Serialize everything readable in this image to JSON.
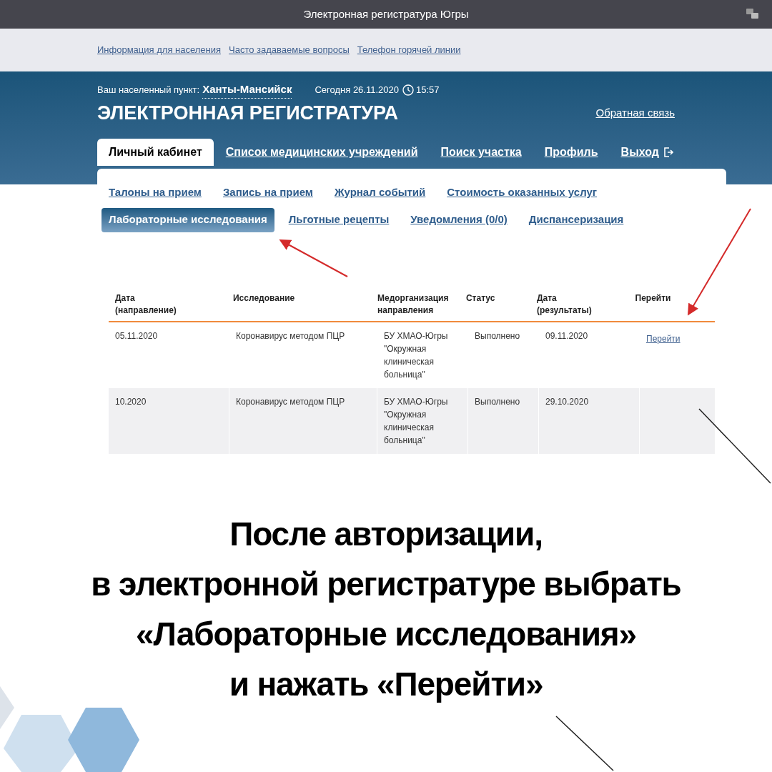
{
  "window": {
    "title": "Электронная регистратура Югры"
  },
  "top_links": [
    "Информация для населения",
    "Часто задаваемые вопросы",
    "Телефон горячей линии"
  ],
  "header": {
    "location_label": "Ваш населенный пункт:",
    "location": "Ханты-Мансийск",
    "today": "Сегодня 26.11.2020",
    "time": "15:57",
    "title": "ЭЛЕКТРОННАЯ РЕГИСТРАТУРА",
    "feedback": "Обратная связь"
  },
  "main_tabs": [
    {
      "label": "Личный кабинет",
      "selected": true,
      "kind": "tab"
    },
    {
      "label": "Список медицинских учреждений",
      "selected": false,
      "kind": "tab"
    },
    {
      "label": "Поиск участка",
      "selected": false,
      "kind": "tab"
    },
    {
      "label": "Профиль",
      "selected": false,
      "kind": "tab"
    },
    {
      "label": "Выход",
      "selected": false,
      "kind": "logout"
    }
  ],
  "sub_tabs": [
    [
      {
        "label": "Талоны на прием",
        "selected": false
      },
      {
        "label": "Запись на прием",
        "selected": false
      },
      {
        "label": "Журнал событий",
        "selected": false
      },
      {
        "label": "Стоимость оказанных услуг",
        "selected": false
      }
    ],
    [
      {
        "label": "Лабораторные исследования",
        "selected": true
      },
      {
        "label": "Льготные рецепты",
        "selected": false
      },
      {
        "label": "Уведомления (0/0)",
        "selected": false
      },
      {
        "label": "Диспансеризация",
        "selected": false
      }
    ]
  ],
  "table": {
    "columns": [
      "Дата (направление)",
      "Исследование",
      "Медорганизация направления",
      "Статус",
      "Дата (результаты)",
      "Перейти"
    ],
    "rows": [
      {
        "cells": [
          "05.11.2020",
          "Коронавирус методом ПЦР",
          "БУ ХМАО-Югры \"Окружная клиническая больница\"",
          "Выполнено",
          "09.11.2020"
        ],
        "link": "Перейти"
      },
      {
        "cells": [
          "10.2020",
          "Коронавирус методом ПЦР",
          "БУ ХМАО-Югры \"Окружная клиническая больница\"",
          "Выполнено",
          "29.10.2020"
        ]
      }
    ]
  },
  "caption": [
    "После авторизации,",
    "в электронной регистратуре выбрать",
    "«Лабораторные исследования»",
    "и нажать «Перейти»"
  ]
}
